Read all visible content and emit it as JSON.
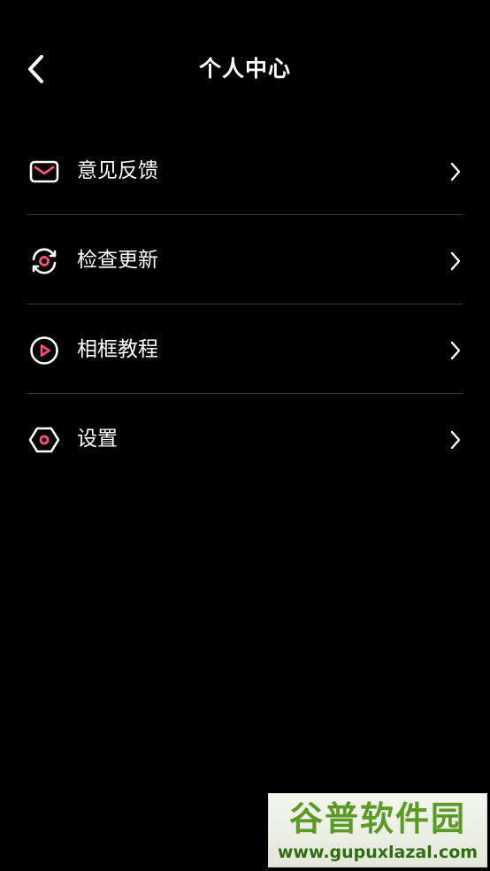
{
  "header": {
    "title": "个人中心",
    "back_icon": "chevron-left-icon"
  },
  "menu": {
    "items": [
      {
        "label": "意见反馈",
        "icon": "mail-icon"
      },
      {
        "label": "检查更新",
        "icon": "refresh-icon"
      },
      {
        "label": "相框教程",
        "icon": "play-circle-icon"
      },
      {
        "label": "设置",
        "icon": "hexagon-settings-icon"
      }
    ]
  },
  "watermark": {
    "title": "谷普软件园",
    "url": "www.gupuxlazal.com"
  },
  "colors": {
    "background": "#000000",
    "text": "#ffffff",
    "accent": "#ff4f7a",
    "divider": "#3a3a3a",
    "watermark_green": "#5b9a24"
  }
}
